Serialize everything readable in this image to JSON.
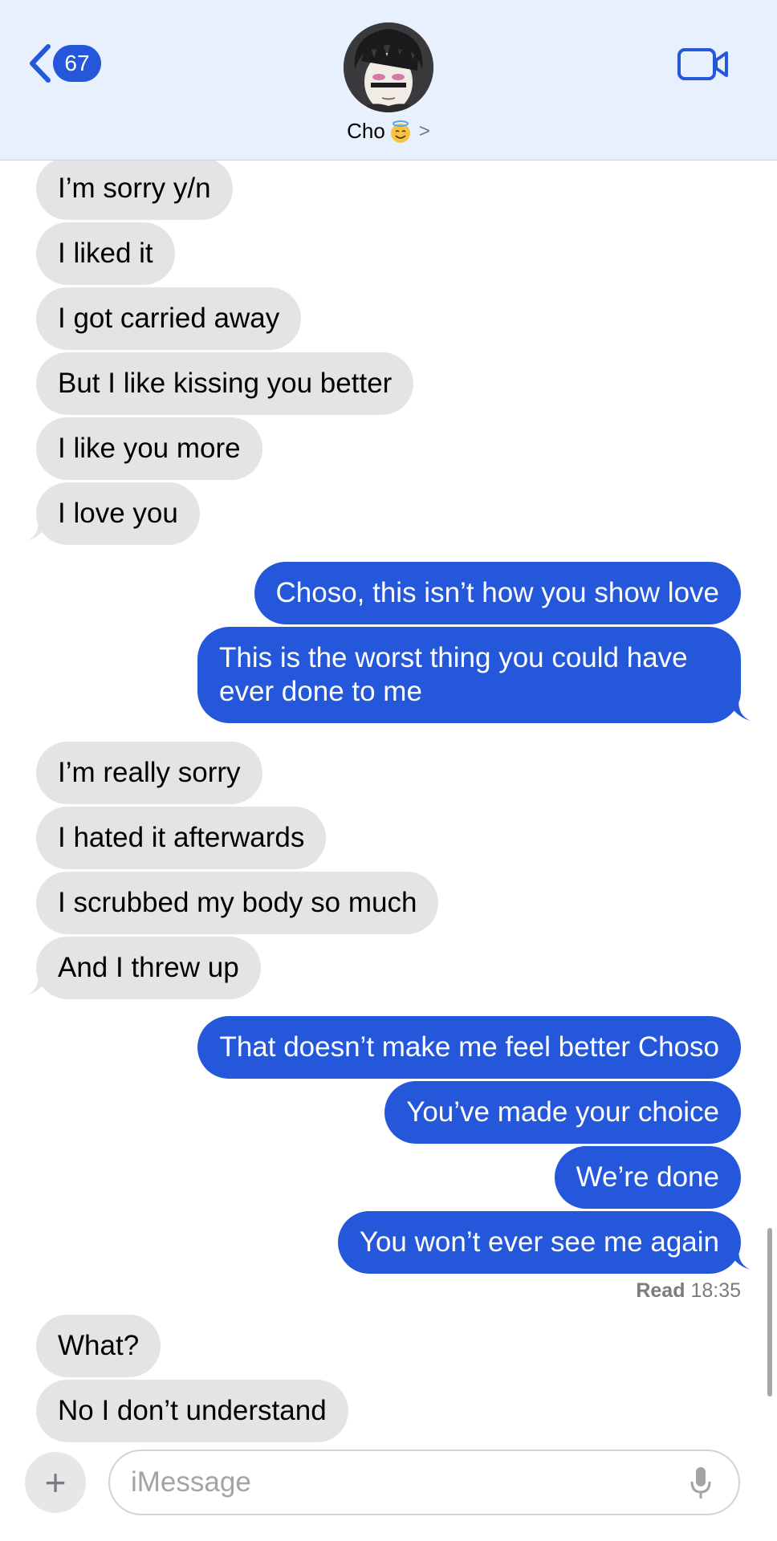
{
  "header": {
    "back_count": "67",
    "contact_name": "Cho",
    "contact_chevron": ">"
  },
  "messages": [
    {
      "dir": "in",
      "text": "I’m sorry y/n"
    },
    {
      "dir": "in",
      "text": "I liked it"
    },
    {
      "dir": "in",
      "text": "I got carried away"
    },
    {
      "dir": "in",
      "text": "But I like kissing you better"
    },
    {
      "dir": "in",
      "text": "I like you more"
    },
    {
      "dir": "in",
      "text": "I love you"
    },
    {
      "dir": "out",
      "text": "Choso, this isn’t how you show love"
    },
    {
      "dir": "out",
      "text": "This is the worst thing you could have ever done to me"
    },
    {
      "dir": "in",
      "text": "I’m really sorry"
    },
    {
      "dir": "in",
      "text": "I hated it afterwards"
    },
    {
      "dir": "in",
      "text": "I scrubbed my body so much"
    },
    {
      "dir": "in",
      "text": "And I threw up"
    },
    {
      "dir": "out",
      "text": "That doesn’t make me feel better Choso"
    },
    {
      "dir": "out",
      "text": "You’ve made your choice"
    },
    {
      "dir": "out",
      "text": "We’re done"
    },
    {
      "dir": "out",
      "text": "You won’t ever see me again"
    },
    {
      "dir": "in",
      "text": "What?"
    },
    {
      "dir": "in",
      "text": "No I don’t understand"
    }
  ],
  "receipt": {
    "label": "Read",
    "time": "18:35"
  },
  "composer": {
    "placeholder": "iMessage",
    "plus": "+"
  },
  "colors": {
    "outgoing": "#2457d9",
    "incoming": "#e4e4e6",
    "header_bg": "#e7f0fc"
  },
  "icons": [
    "back-chevron-icon",
    "video-camera-icon",
    "halo-smile-emoji",
    "plus-icon",
    "microphone-icon"
  ]
}
